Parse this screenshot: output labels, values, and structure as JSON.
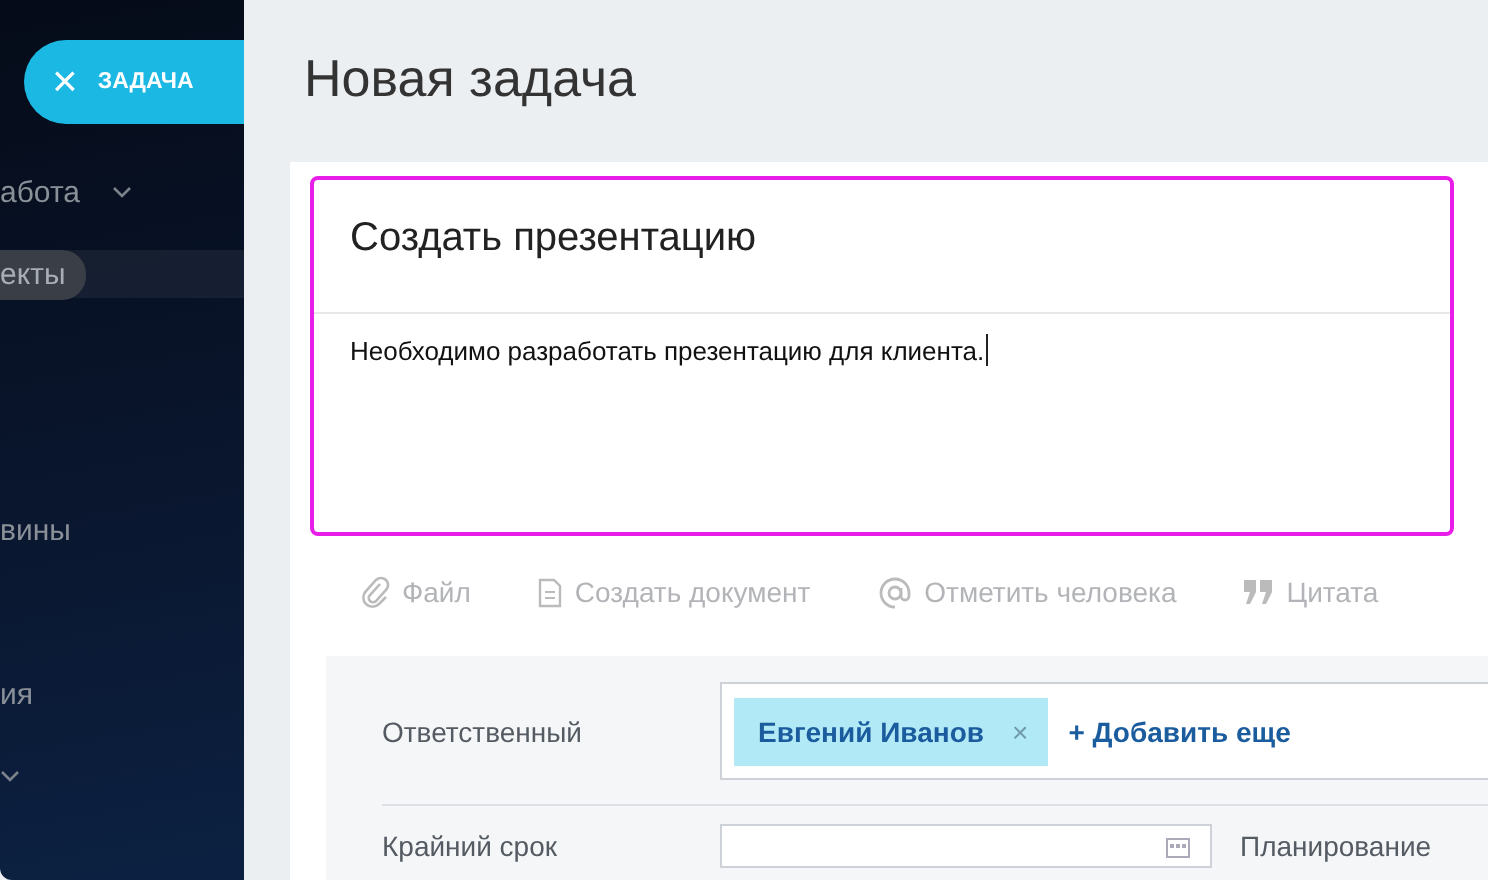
{
  "sidebar": {
    "task_button": {
      "icon": "×",
      "label": "ЗАДАЧА"
    },
    "items": [
      {
        "label": "абота",
        "expandable": true,
        "selected": false
      },
      {
        "label": "екты",
        "expandable": false,
        "selected": true
      },
      {
        "label": "вины",
        "expandable": false,
        "selected": false
      },
      {
        "label": "ия",
        "expandable": false,
        "selected": false
      },
      {
        "expandable": true,
        "selected": false
      }
    ]
  },
  "page_title": "Новая задача",
  "editor": {
    "title": "Создать презентацию",
    "body": "Необходимо разработать презентацию для клиента.",
    "focused": true
  },
  "toolbar": [
    {
      "kind": "clip",
      "label": "Файл"
    },
    {
      "kind": "doc",
      "label": "Создать документ"
    },
    {
      "kind": "at",
      "label": "Отметить человека"
    },
    {
      "kind": "quote",
      "label": "Цитата"
    }
  ],
  "responsible": {
    "label": "Ответственный",
    "people": [
      {
        "name": "Евгений Иванов",
        "remove": "×"
      }
    ],
    "add_link": "+ Добавить еще"
  },
  "deadline": {
    "label": "Крайний срок"
  },
  "planning": {
    "label": "Планирование"
  }
}
